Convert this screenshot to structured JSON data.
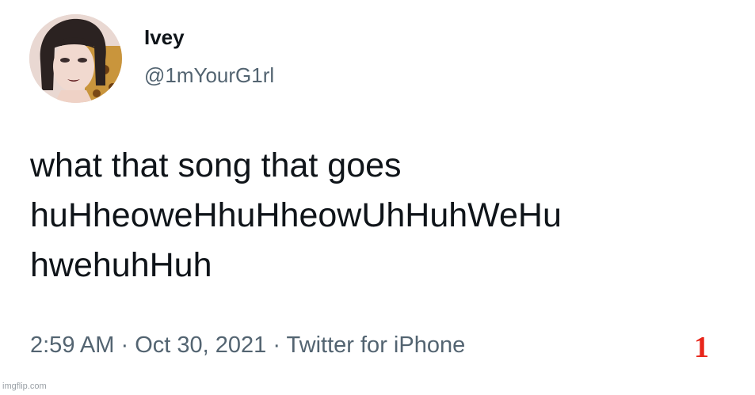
{
  "author": {
    "display_name": "Ivey",
    "handle": "@1mYourG1rl"
  },
  "tweet": {
    "lines": [
      "what that song that goes",
      "huHheoweHhuHheowUhHuhWeHu",
      "hwehuhHuh"
    ],
    "time": "2:59 AM",
    "date": "Oct 30, 2021",
    "source": "Twitter for iPhone",
    "separator": "·"
  },
  "overlay": {
    "number": "1",
    "color": "#e8261b"
  },
  "watermark": "imgflip.com",
  "colors": {
    "text_primary": "#0f1419",
    "text_secondary": "#536471",
    "background": "#ffffff"
  }
}
